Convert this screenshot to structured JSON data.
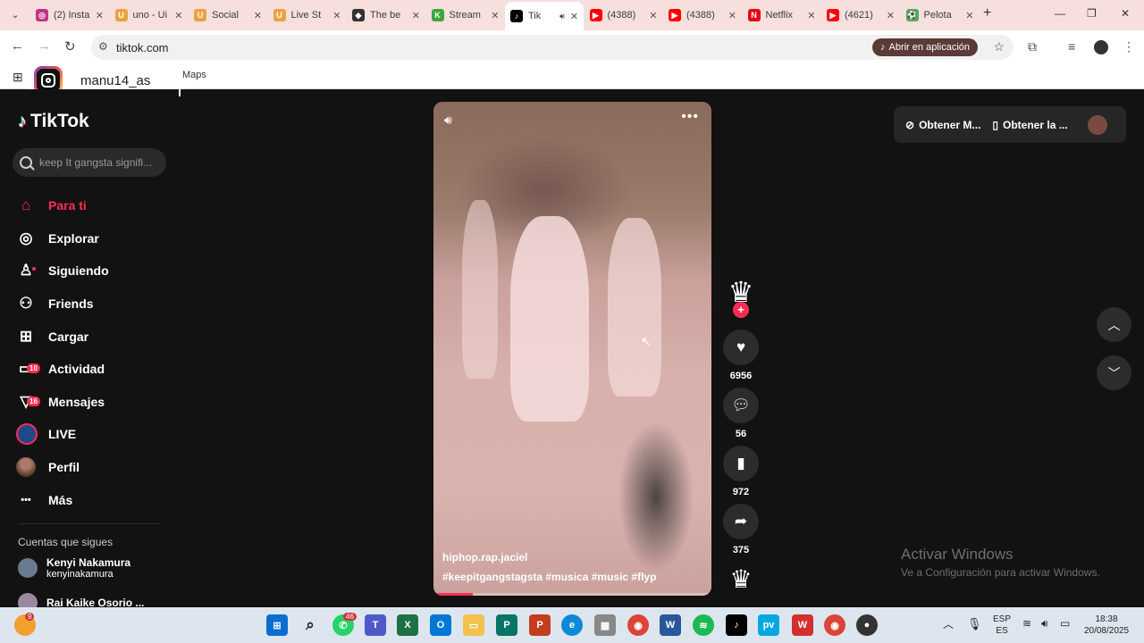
{
  "browser": {
    "tabs": [
      {
        "title": "(2) Insta",
        "fav_color": "#c13584",
        "fav_glyph": "◎"
      },
      {
        "title": "uno - Ui",
        "fav_color": "#e8a33d",
        "fav_glyph": "U"
      },
      {
        "title": "Social",
        "fav_color": "#e8a33d",
        "fav_glyph": "U"
      },
      {
        "title": "Live St",
        "fav_color": "#e8a33d",
        "fav_glyph": "U"
      },
      {
        "title": "The be",
        "fav_color": "#333333",
        "fav_glyph": "◆"
      },
      {
        "title": "Stream",
        "fav_color": "#3aa83a",
        "fav_glyph": "K"
      },
      {
        "title": "Tik",
        "fav_color": "#000000",
        "fav_glyph": "♪",
        "active": true
      },
      {
        "title": "(4388)",
        "fav_color": "#ff0000",
        "fav_glyph": "▶"
      },
      {
        "title": "(4388)",
        "fav_color": "#ff0000",
        "fav_glyph": "▶"
      },
      {
        "title": "Netflix",
        "fav_color": "#e50914",
        "fav_glyph": "N"
      },
      {
        "title": "(4621)",
        "fav_color": "#ff0000",
        "fav_glyph": "▶"
      },
      {
        "title": "Pelota",
        "fav_color": "#4caf50",
        "fav_glyph": "⚽"
      }
    ],
    "url": "tiktok.com",
    "open_app_label": "Abrir en aplicación",
    "bookmark_label": "Maps"
  },
  "instagram_overlay": {
    "username": "manu14_as"
  },
  "tiktok": {
    "brand": "TikTok",
    "search_placeholder": "keep It gangsta signifi...",
    "nav": [
      {
        "label": "Para ti",
        "icon": "home-icon",
        "active": true
      },
      {
        "label": "Explorar",
        "icon": "compass-icon"
      },
      {
        "label": "Siguiendo",
        "icon": "following-icon"
      },
      {
        "label": "Friends",
        "icon": "friends-icon"
      },
      {
        "label": "Cargar",
        "icon": "upload-icon"
      },
      {
        "label": "Actividad",
        "icon": "activity-icon",
        "badge": "10"
      },
      {
        "label": "Mensajes",
        "icon": "messages-icon",
        "badge": "16"
      },
      {
        "label": "LIVE",
        "icon": "live-icon"
      },
      {
        "label": "Perfil",
        "icon": "profile-icon"
      },
      {
        "label": "Más",
        "icon": "more-icon"
      }
    ],
    "following_title": "Cuentas que sigues",
    "following": [
      {
        "name": "Kenyi Nakamura",
        "handle": "kenyinakamura"
      },
      {
        "name": "Rai Kaike Osorio ...",
        "handle": ""
      }
    ],
    "video": {
      "author": "hiphop.rap.jaciel",
      "tags": "#keepitgangstagsta  #musica  #music  #flyp",
      "progress": 0.14
    },
    "actions": {
      "likes": "6956",
      "comments": "56",
      "saves": "972",
      "shares": "375"
    },
    "top_right": {
      "get_coins": "Obtener M...",
      "get_app": "Obtener la ..."
    }
  },
  "windows": {
    "watermark_title": "Activar Windows",
    "watermark_sub": "Ve a Configuración para activar Windows.",
    "taskbar": {
      "weather_badge": "9",
      "whatsapp_badge": "46",
      "lang_top": "ESP",
      "lang_bottom": "ES",
      "time": "18:38",
      "date": "20/08/2025"
    }
  }
}
